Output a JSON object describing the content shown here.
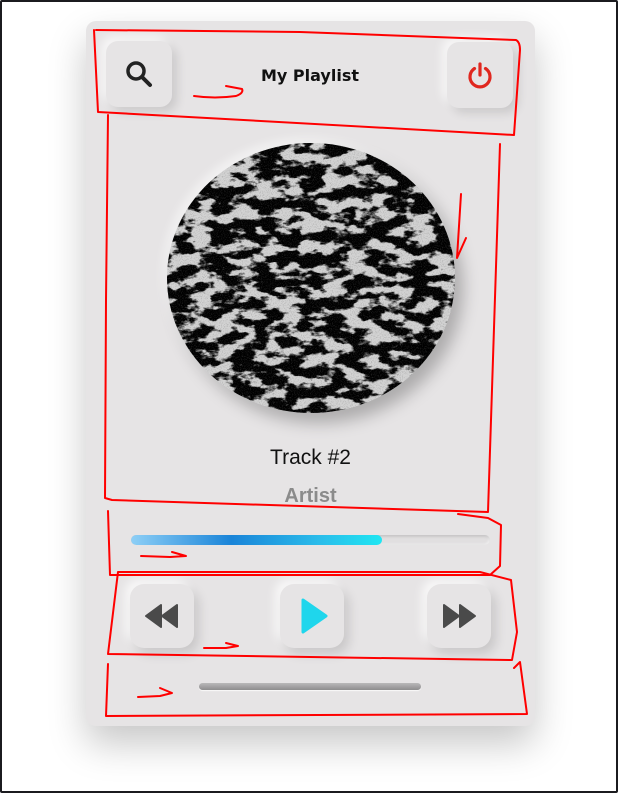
{
  "header": {
    "title": "My Playlist",
    "search_icon": "search-icon",
    "power_icon": "power-icon"
  },
  "now_playing": {
    "track": "Track #2",
    "artist": "Artist",
    "progress_fraction": 0.7
  },
  "controls": {
    "previous_icon": "rewind-icon",
    "play_icon": "play-icon",
    "next_icon": "fast-forward-icon"
  },
  "colors": {
    "accent_play": "#1fd6ec",
    "power": "#e0271f",
    "annotation": "#ff0000",
    "card": "#e6e4e5"
  }
}
